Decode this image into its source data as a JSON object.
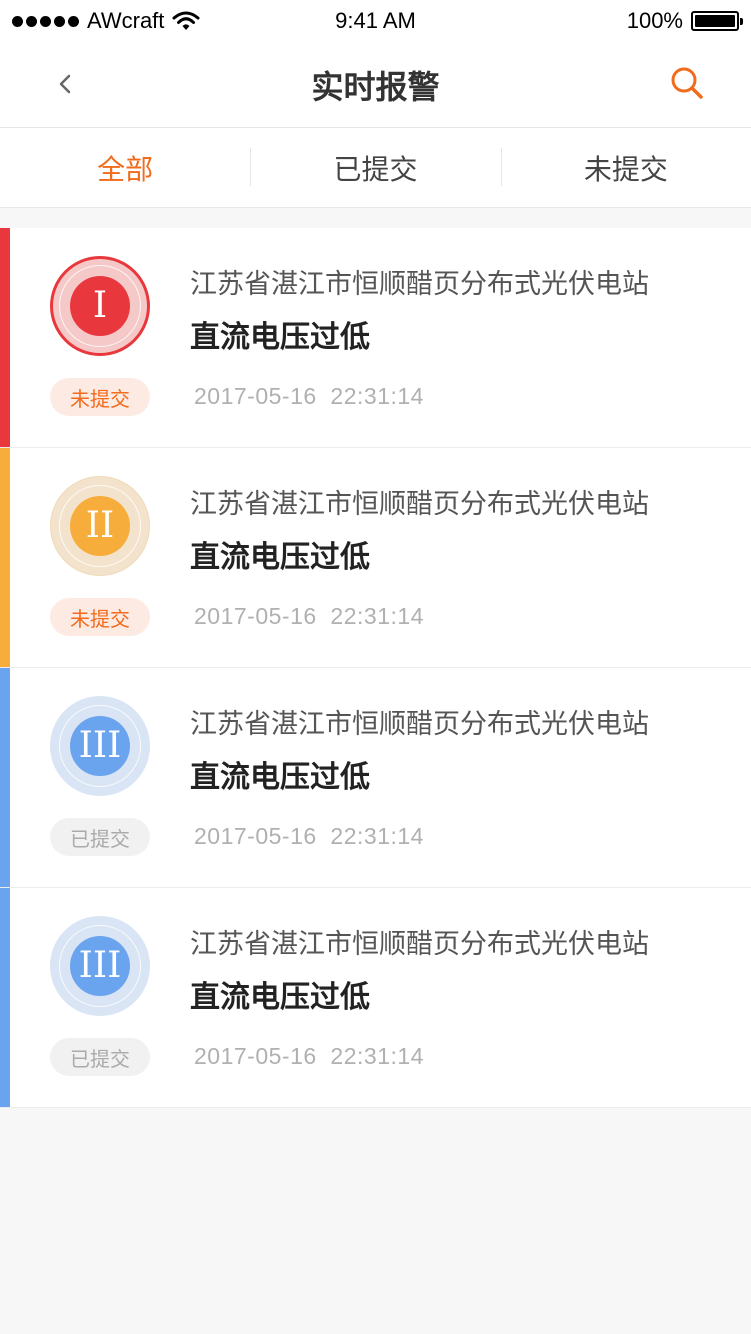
{
  "status_bar": {
    "carrier": "AWcraft",
    "time": "9:41 AM",
    "battery": "100%"
  },
  "nav": {
    "title": "实时报警",
    "back_icon": "chevron-left-icon",
    "search_icon": "search-icon",
    "accent_color": "#f26a1b"
  },
  "tabs": [
    {
      "label": "全部",
      "active": true
    },
    {
      "label": "已提交",
      "active": false
    },
    {
      "label": "未提交",
      "active": false
    }
  ],
  "alarms": [
    {
      "level": "I",
      "station": "江苏省湛江市恒顺醋页分布式光伏电站",
      "name": "直流电压过低",
      "status": "未提交",
      "time": "2017-05-16  22:31:14",
      "bar_color": "#e8383d",
      "core_color": "#e8383d",
      "halo_color": "#f6c9c9",
      "outer_ring": "#e8383d",
      "pill_bg": "#fdebe3",
      "pill_color": "#f26a1b"
    },
    {
      "level": "II",
      "station": "江苏省湛江市恒顺醋页分布式光伏电站",
      "name": "直流电压过低",
      "status": "未提交",
      "time": "2017-05-16  22:31:14",
      "bar_color": "#f7ad3c",
      "core_color": "#f7ad3c",
      "halo_color": "#f4e3cc",
      "outer_ring": "#f0d9b8",
      "pill_bg": "#fdebe3",
      "pill_color": "#f26a1b"
    },
    {
      "level": "III",
      "station": "江苏省湛江市恒顺醋页分布式光伏电站",
      "name": "直流电压过低",
      "status": "已提交",
      "time": "2017-05-16  22:31:14",
      "bar_color": "#6aa4ef",
      "core_color": "#6aa4ef",
      "halo_color": "#d9e5f4",
      "outer_ring": "#d9e5f4",
      "pill_bg": "#f1f1f1",
      "pill_color": "#aaaaaa"
    },
    {
      "level": "III",
      "station": "江苏省湛江市恒顺醋页分布式光伏电站",
      "name": "直流电压过低",
      "status": "已提交",
      "time": "2017-05-16  22:31:14",
      "bar_color": "#6aa4ef",
      "core_color": "#6aa4ef",
      "halo_color": "#d9e5f4",
      "outer_ring": "#d9e5f4",
      "pill_bg": "#f1f1f1",
      "pill_color": "#aaaaaa"
    }
  ]
}
